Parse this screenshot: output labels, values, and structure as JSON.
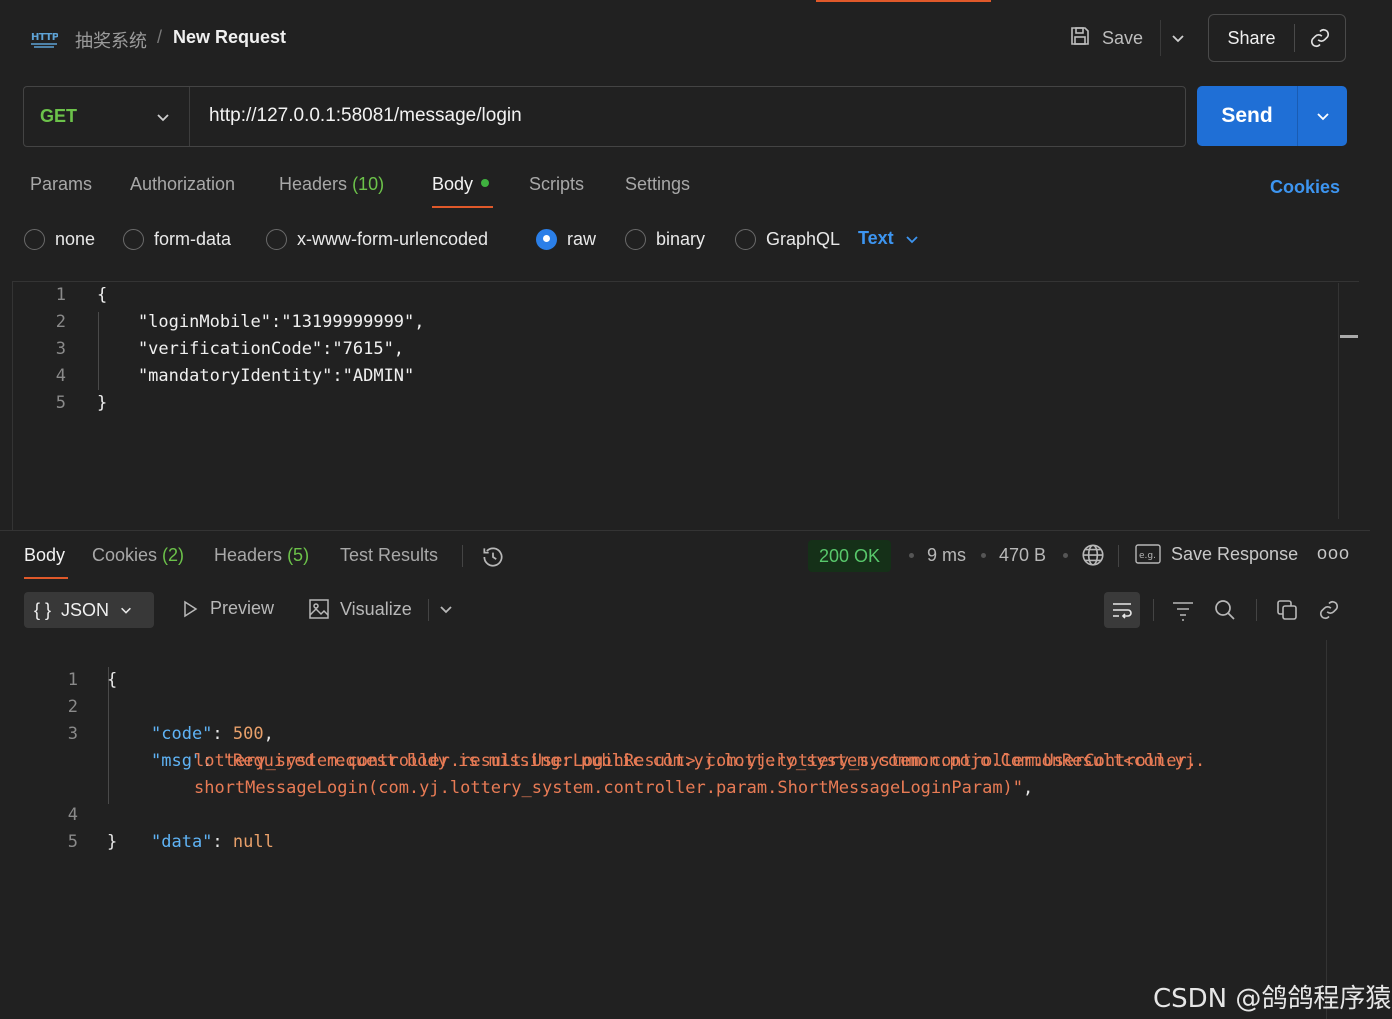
{
  "header": {
    "collection": "抽奖系统",
    "separator": "/",
    "request_name": "New Request",
    "http_badge": "HTTP",
    "save_label": "Save",
    "share_label": "Share"
  },
  "request": {
    "method": "GET",
    "url": "http://127.0.0.1:58081/message/login",
    "send_label": "Send"
  },
  "tabs": [
    {
      "label": "Params",
      "count": ""
    },
    {
      "label": "Authorization",
      "count": ""
    },
    {
      "label": "Headers",
      "count": "(10)"
    },
    {
      "label": "Body",
      "count": ""
    },
    {
      "label": "Scripts",
      "count": ""
    },
    {
      "label": "Settings",
      "count": ""
    }
  ],
  "active_tab": "Body",
  "cookies_link": "Cookies",
  "body_types": [
    {
      "label": "none",
      "selected": false
    },
    {
      "label": "form-data",
      "selected": false
    },
    {
      "label": "x-www-form-urlencoded",
      "selected": false
    },
    {
      "label": "raw",
      "selected": true
    },
    {
      "label": "binary",
      "selected": false
    },
    {
      "label": "GraphQL",
      "selected": false
    }
  ],
  "raw_format": "Text",
  "request_body": {
    "line_numbers": [
      "1",
      "2",
      "3",
      "4",
      "5"
    ],
    "lines": [
      "{",
      "    \"loginMobile\":\"13199999999\",",
      "    \"verificationCode\":\"7615\",",
      "    \"mandatoryIdentity\":\"ADMIN\"",
      "}"
    ]
  },
  "response": {
    "tabs": [
      {
        "label": "Body",
        "count": ""
      },
      {
        "label": "Cookies",
        "count": "(2)"
      },
      {
        "label": "Headers",
        "count": "(5)"
      },
      {
        "label": "Test Results",
        "count": ""
      }
    ],
    "status": "200 OK",
    "time": "9 ms",
    "size": "470 B",
    "save_response": "Save Response",
    "more": "ooo",
    "format": "JSON",
    "format_icon": "{ }",
    "preview": "Preview",
    "visualize": "Visualize",
    "line_numbers": [
      "1",
      "2",
      "3",
      "",
      "",
      "4",
      "5"
    ],
    "code_value": "500",
    "msg_line1": "\"Required request body is missing: public com.yj.lottery_system.common.pojo.CommonResult<com.yj.",
    "msg_line2": "lottery_system.controller.result.UserLoginResult> com.yj.lottery_system.controller.UserController.",
    "msg_line3": "shortMessageLogin(com.yj.lottery_system.controller.param.ShortMessageLoginParam)\"",
    "data_value": "null",
    "key_code": "\"code\"",
    "key_msg": "\"msg\"",
    "key_data": "\"data\""
  },
  "watermark": "CSDN @鸽鸽程序猿",
  "colors": {
    "accent": "#e0592a",
    "send": "#1f6fd6",
    "method_get": "#6cc24a",
    "link": "#3d95f0",
    "status_ok": "#58c76b"
  }
}
